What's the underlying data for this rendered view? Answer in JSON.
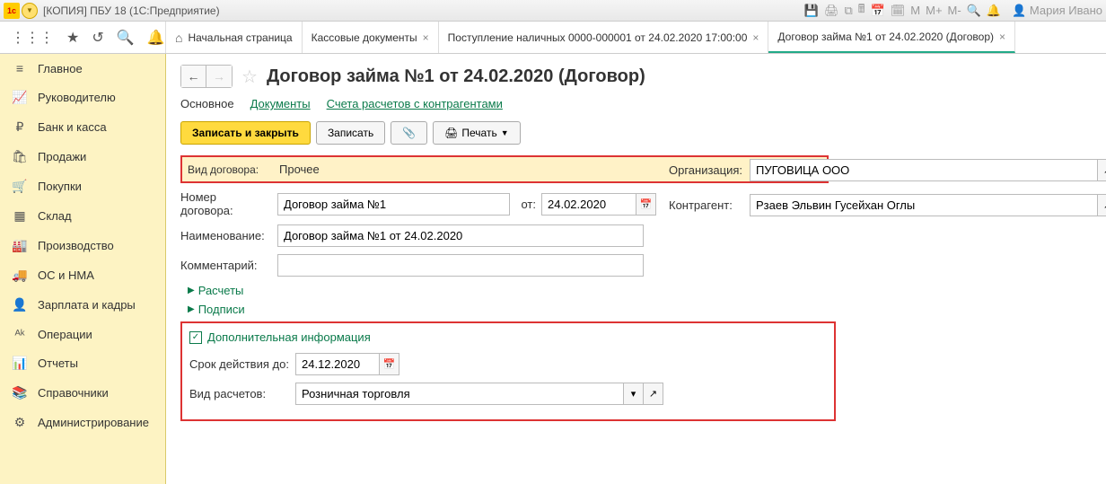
{
  "titlebar": {
    "logo": "1c",
    "title": "[КОПИЯ] ПБУ 18  (1С:Предприятие)",
    "user": "Мария Ивано",
    "icons": {
      "m": "M",
      "mplus": "M+",
      "mminus": "M-"
    }
  },
  "toolbar": {
    "tabs": [
      {
        "label": "Начальная страница",
        "home": true,
        "closable": false,
        "active": false
      },
      {
        "label": "Кассовые документы",
        "closable": true,
        "active": false
      },
      {
        "label": "Поступление наличных 0000-000001 от 24.02.2020 17:00:00",
        "closable": true,
        "active": false
      },
      {
        "label": "Договор займа №1 от 24.02.2020 (Договор)",
        "closable": true,
        "active": true
      }
    ]
  },
  "sidebar": {
    "items": [
      {
        "icon": "≡",
        "label": "Главное"
      },
      {
        "icon": "📈",
        "label": "Руководителю"
      },
      {
        "icon": "₽",
        "label": "Банк и касса"
      },
      {
        "icon": "🛍",
        "label": "Продажи"
      },
      {
        "icon": "🛒",
        "label": "Покупки"
      },
      {
        "icon": "▦",
        "label": "Склад"
      },
      {
        "icon": "🏭",
        "label": "Производство"
      },
      {
        "icon": "🚚",
        "label": "ОС и НМА"
      },
      {
        "icon": "👤",
        "label": "Зарплата и кадры"
      },
      {
        "icon": "ᴬᵏ",
        "label": "Операции"
      },
      {
        "icon": "📊",
        "label": "Отчеты"
      },
      {
        "icon": "📚",
        "label": "Справочники"
      },
      {
        "icon": "⚙",
        "label": "Администрирование"
      }
    ]
  },
  "page": {
    "title": "Договор займа №1 от 24.02.2020 (Договор)",
    "subtabs": {
      "main": "Основное",
      "docs": "Документы",
      "accounts": "Счета расчетов с контрагентами"
    },
    "actions": {
      "save_close": "Записать и закрыть",
      "save": "Записать",
      "print": "Печать"
    }
  },
  "form": {
    "contract_type_label": "Вид договора:",
    "contract_type_value": "Прочее",
    "number_label": "Номер договора:",
    "number_value": "Договор займа №1",
    "from_label": "от:",
    "from_value": "24.02.2020",
    "name_label": "Наименование:",
    "name_value": "Договор займа №1 от 24.02.2020",
    "comment_label": "Комментарий:",
    "comment_value": "",
    "org_label": "Организация:",
    "org_value": "ПУГОВИЦА ООО",
    "counterparty_label": "Контрагент:",
    "counterparty_value": "Рзаев Эльвин Гусейхан Оглы",
    "exp_calc": "Расчеты",
    "exp_sign": "Подписи",
    "addinfo_title": "Дополнительная информация",
    "valid_label": "Срок действия до:",
    "valid_value": "24.12.2020",
    "calc_type_label": "Вид расчетов:",
    "calc_type_value": "Розничная торговля"
  }
}
